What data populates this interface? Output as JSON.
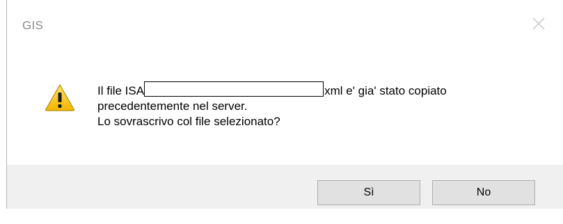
{
  "dialog": {
    "title": "GIS",
    "message": {
      "line1_prefix": "Il file ISA",
      "line1_suffix": "xml e' gia' stato copiato",
      "line2": "precedentemente nel server.",
      "line3": "Lo sovrascrivo col file selezionato?"
    },
    "icon": "warning-icon",
    "buttons": {
      "yes_label": "Sì",
      "no_label": "No"
    }
  },
  "colors": {
    "footer_bg": "#f0f0f0",
    "button_bg": "#e1e1e1",
    "button_border": "#adadad",
    "warning_fill": "#f5c400"
  }
}
